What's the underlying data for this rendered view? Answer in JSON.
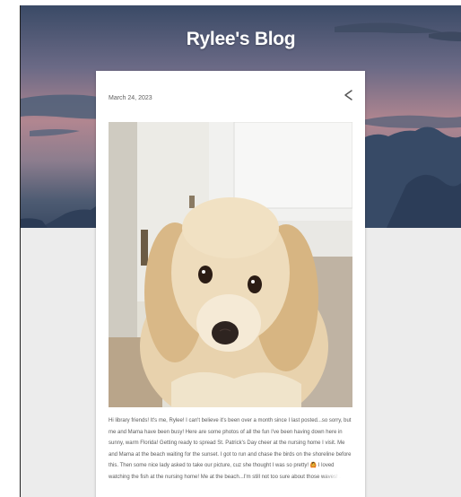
{
  "blog": {
    "title": "Rylee's Blog"
  },
  "post": {
    "date": "March 24, 2023",
    "excerpt": "Hi library friends! It's me, Rylee!  I can't believe it's been over a month since I last posted...so sorry, but me and Mama have been busy!   Here are some photos of all the fun I've been having down here in sunny, warm Florida! Getting ready to spread St. Patrick's Day cheer at the nursing home I visit. Me and Mama at the beach waiting for the sunset. I got to run and chase the birds on the shoreline before this. Then some nice lady asked to take our picture, cuz she thought I was so pretty! 🙆 I loved watching the fish at the nursing home! Me at the beach...I'm still not too sure about those waves! ...",
    "share_icon": "share-icon",
    "photo_subject": "golden-retriever-photo"
  },
  "colors": {
    "page_bg": "#ececec",
    "card_bg": "#ffffff",
    "title_text": "#ffffff"
  }
}
